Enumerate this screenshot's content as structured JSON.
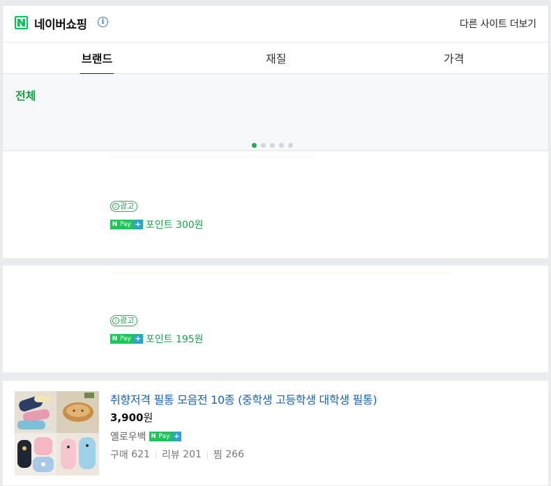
{
  "header": {
    "brand_title": "네이버쇼핑",
    "info_icon": "info-icon",
    "more_sites": "다른 사이트 더보기"
  },
  "tabs": [
    {
      "label": "브랜드",
      "active": true
    },
    {
      "label": "재질",
      "active": false
    },
    {
      "label": "가격",
      "active": false
    }
  ],
  "filter": {
    "all_label": "전체",
    "page_dots": 5,
    "active_dot": 1
  },
  "ads": [
    {
      "badge": "광고",
      "npay": {
        "n": "N",
        "pay": "Pay",
        "plus": "+"
      },
      "point": "포인트 300원"
    },
    {
      "badge": "광고",
      "npay": {
        "n": "N",
        "pay": "Pay",
        "plus": "+"
      },
      "point": "포인트 195원"
    }
  ],
  "product": {
    "title": "취향저격 필통 모음전 10종 (중학생 고등학생 대학생 필통)",
    "price_value": "3,900",
    "price_unit": "원",
    "seller": "옐로우백",
    "npay": {
      "n": "N",
      "pay": "Pay",
      "plus": "+"
    },
    "purchase_label": "구매",
    "purchase_count": "621",
    "review_label": "리뷰",
    "review_count": "201",
    "wish_label": "찜",
    "wish_count": "266"
  },
  "colors": {
    "naver_green": "#03c75a",
    "link_blue": "#1862b8",
    "point_green": "#16a34a",
    "active_dot": "#1cb04c"
  }
}
